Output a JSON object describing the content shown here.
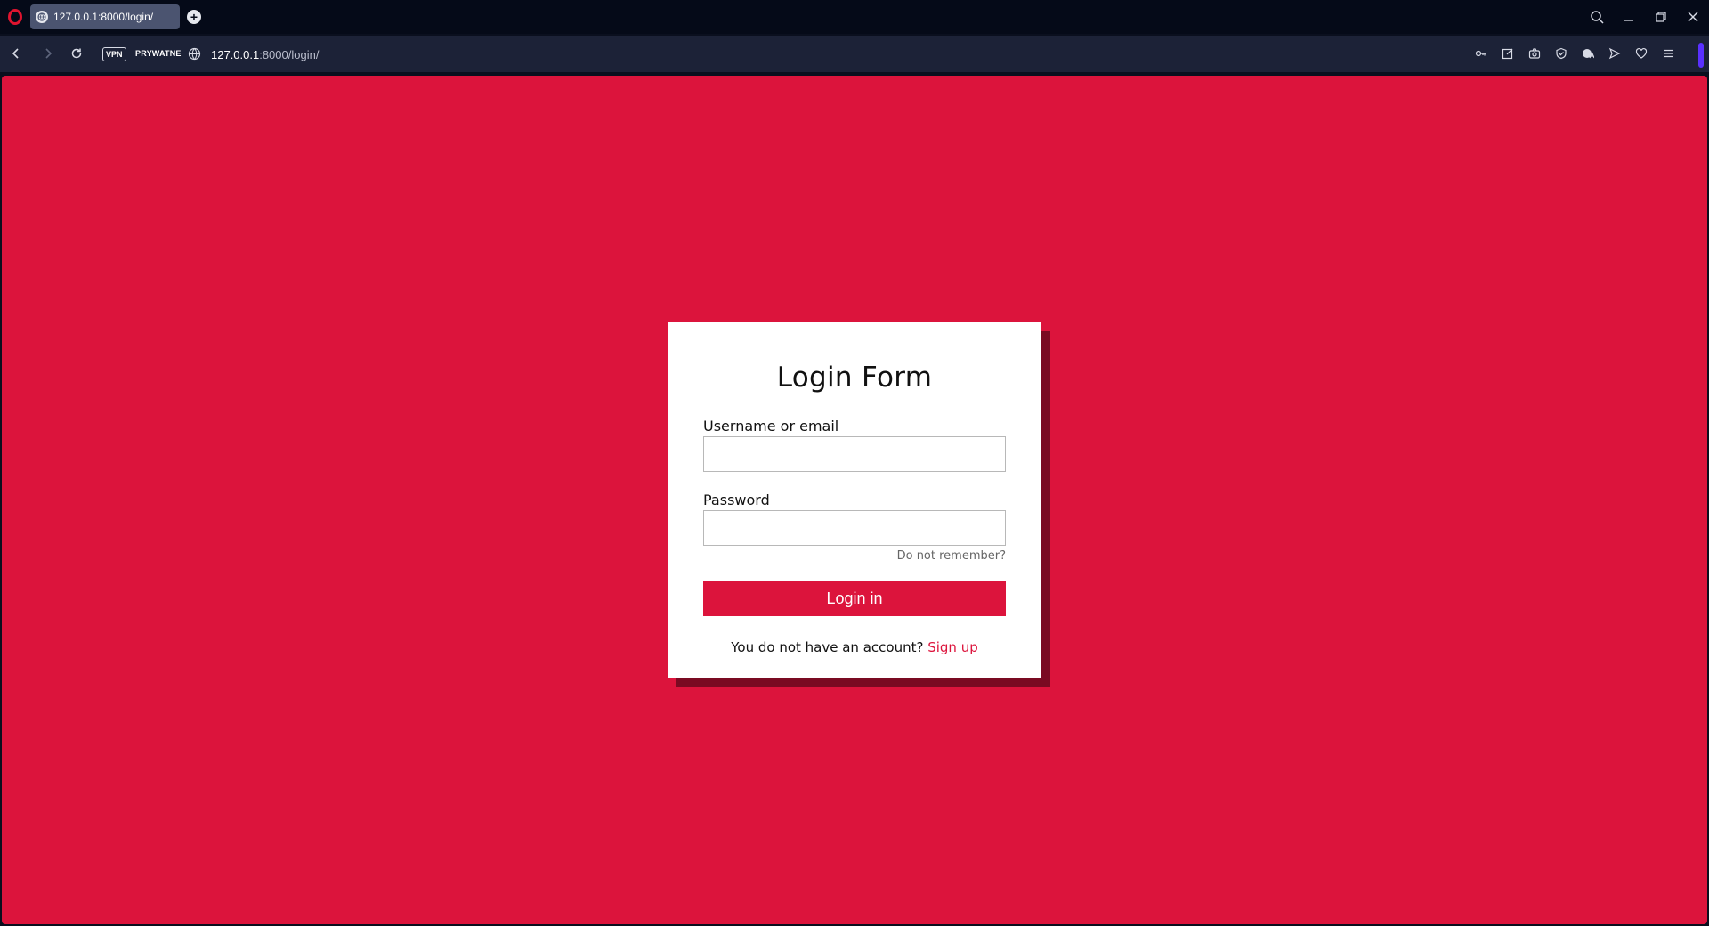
{
  "browser": {
    "tab_title": "127.0.0.1:8000/login/",
    "new_tab_symbol": "+",
    "vpn_label": "VPN",
    "private_label": "PRYWATNE",
    "url_host": "127.0.0.1",
    "url_path": ":8000/login/",
    "accent_color": "#e0142f",
    "toolbar_icons": [
      "key-icon",
      "edit-icon",
      "camera-icon",
      "shield-icon",
      "translate-icon",
      "send-icon",
      "heart-icon",
      "menu-icon"
    ]
  },
  "page": {
    "background_color": "#dc143c",
    "form": {
      "title": "Login Form",
      "username_label": "Username or email",
      "username_value": "",
      "password_label": "Password",
      "password_value": "",
      "forgot_link": "Do not remember?",
      "submit_label": "Login in",
      "signup_prompt": "You do not have an account?",
      "signup_link": "Sign up"
    }
  }
}
